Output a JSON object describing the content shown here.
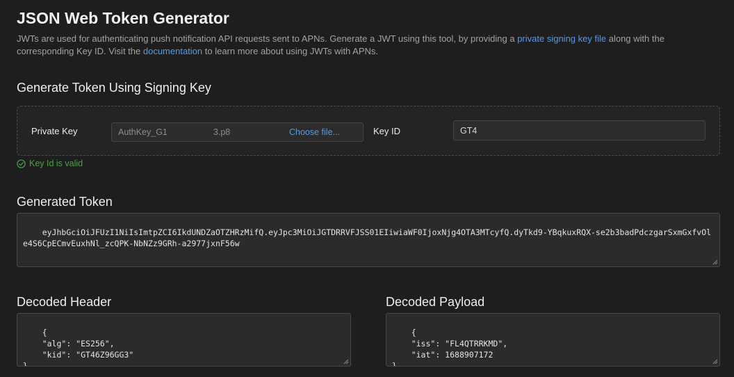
{
  "header": {
    "title": "JSON Web Token Generator",
    "intro_part1": "JWTs are used for authenticating push notification API requests sent to APNs. Generate a JWT using this tool, by providing a ",
    "intro_link1": "private signing key file",
    "intro_part2": " along with the corresponding Key ID. Visit the ",
    "intro_link2": "documentation",
    "intro_part3": " to learn more about using JWTs with APNs."
  },
  "signing": {
    "section_title": "Generate Token Using Signing Key",
    "private_key_label": "Private Key",
    "file_name": "AuthKey_G1",
    "file_suffix": "3.p8",
    "choose_file_label": "Choose file...",
    "key_id_label": "Key ID",
    "key_id_value": "GT4",
    "validation_message": "Key Id is valid"
  },
  "token": {
    "section_title": "Generated Token",
    "value": "eyJhbGciOiJFUzI1NiIsImtpZCI6IkdUNDZaOTZHRzMifQ.eyJpc3MiOiJGTDRRVFJSS01EIiwiaWF0IjoxNjg4OTA3MTcyfQ.dyTkd9-YBqkuxRQX-se2b3badPdczgarSxmGxfvOle4S6CpECmvEuxhNl_zcQPK-NbNZz9GRh-a2977jxnF56w"
  },
  "decoded_header": {
    "section_title": "Decoded Header",
    "value": "{\n    \"alg\": \"ES256\",\n    \"kid\": \"GT46Z96GG3\"\n}"
  },
  "decoded_payload": {
    "section_title": "Decoded Payload",
    "value": "{\n    \"iss\": \"FL4QTRRKMD\",\n    \"iat\": 1688907172\n}"
  },
  "colors": {
    "background": "#1e1e1e",
    "link": "#4b9cf0",
    "success": "#46a546"
  }
}
